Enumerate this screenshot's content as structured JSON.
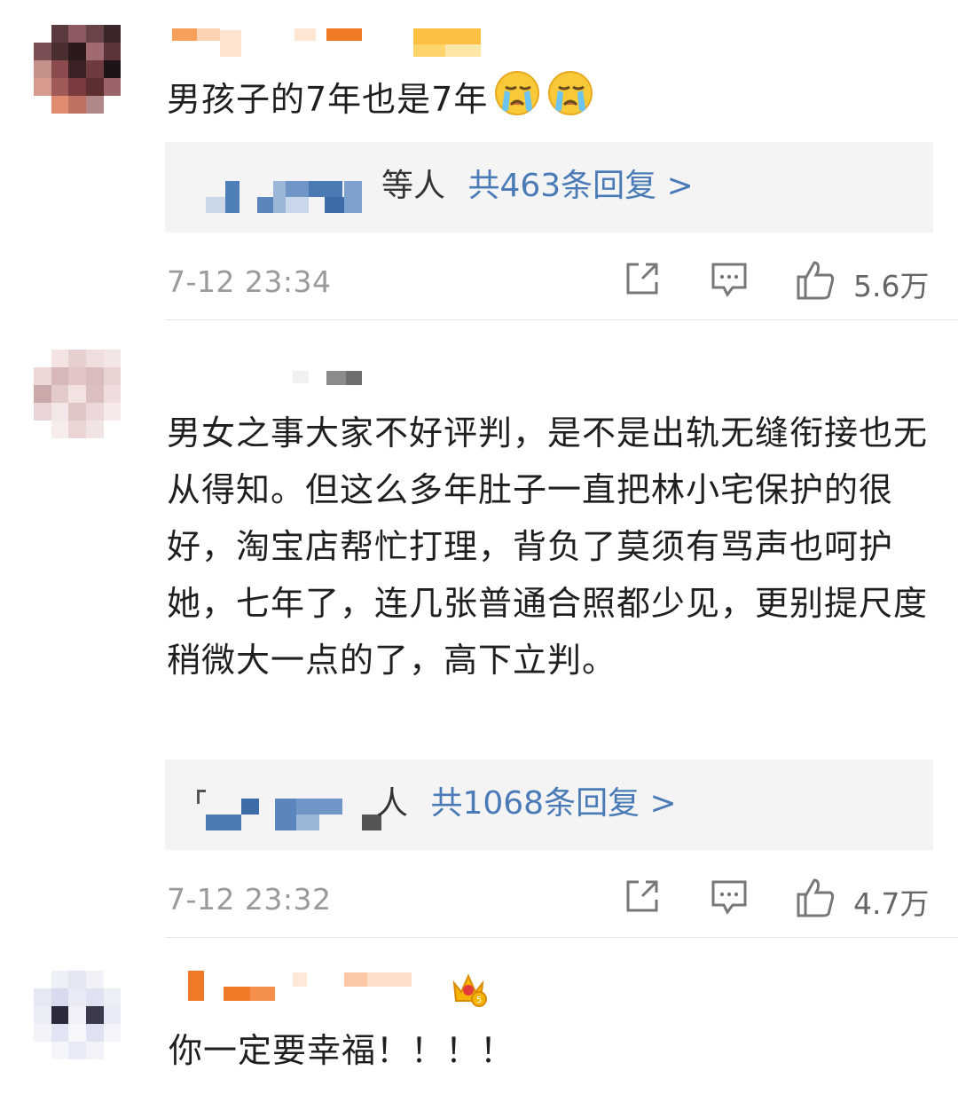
{
  "comments": [
    {
      "text": "男孩子的7年也是7年",
      "emoji_icons": [
        "crying-face-icon",
        "crying-face-icon"
      ],
      "reply_suffix": "等人",
      "reply_summary": "共463条回复 >",
      "time": "7-12 23:34",
      "likes": "5.6万"
    },
    {
      "text": "男女之事大家不好评判，是不是出轨无缝衔接也无从得知。但这么多年肚子一直把林小宅保护的很好，淘宝店帮忙打理，背负了莫须有骂声也呵护她，七年了，连几张普通合照都少见，更别提尺度稍微大一点的了，高下立判。",
      "reply_suffix": "人",
      "reply_summary": "共1068条回复 >",
      "time": "7-12 23:32",
      "likes": "4.7万"
    },
    {
      "text": "你一定要幸福！！！！",
      "badge_icon": "crown-badge-icon"
    }
  ],
  "colors": {
    "link_blue": "#4a7bb7",
    "reply_bg": "#f4f4f4",
    "meta_gray": "#9a9a9a",
    "username_orange": "#f57c2a"
  },
  "icons": [
    "share-icon",
    "comment-icon",
    "like-icon"
  ]
}
